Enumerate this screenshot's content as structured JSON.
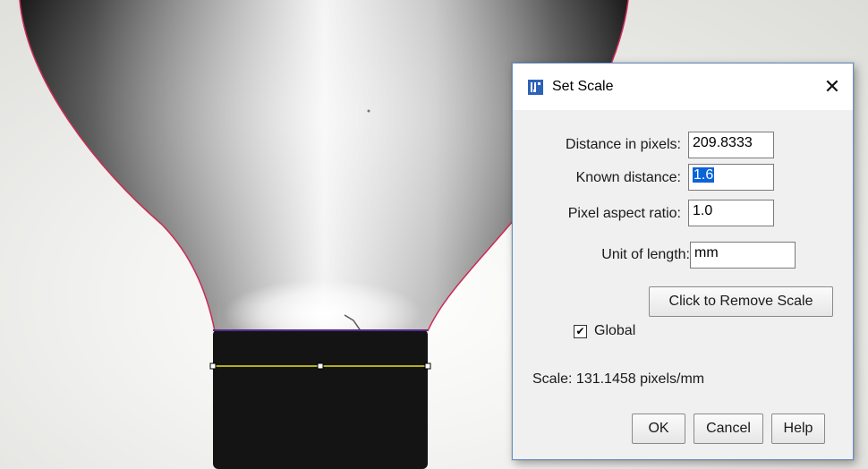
{
  "dialog": {
    "title": "Set Scale",
    "app_icon": "imagej-icon",
    "close_glyph": "✕",
    "fields": {
      "distance_pixels": {
        "label": "Distance in pixels:",
        "value": "209.8333"
      },
      "known_distance": {
        "label": "Known distance:",
        "value": "1.6"
      },
      "aspect_ratio": {
        "label": "Pixel aspect ratio:",
        "value": "1.0"
      },
      "unit": {
        "label": "Unit of length:",
        "value": "mm"
      }
    },
    "remove_scale_label": "Click to Remove Scale",
    "global": {
      "label": "Global",
      "checked": true,
      "check_glyph": "✔"
    },
    "scale_text": "Scale: 131.1458 pixels/mm",
    "buttons": {
      "ok": "OK",
      "cancel": "Cancel",
      "help": "Help"
    }
  },
  "image": {
    "outline_color": "#cc2a55",
    "measurement_line_color": "#e8e020"
  }
}
